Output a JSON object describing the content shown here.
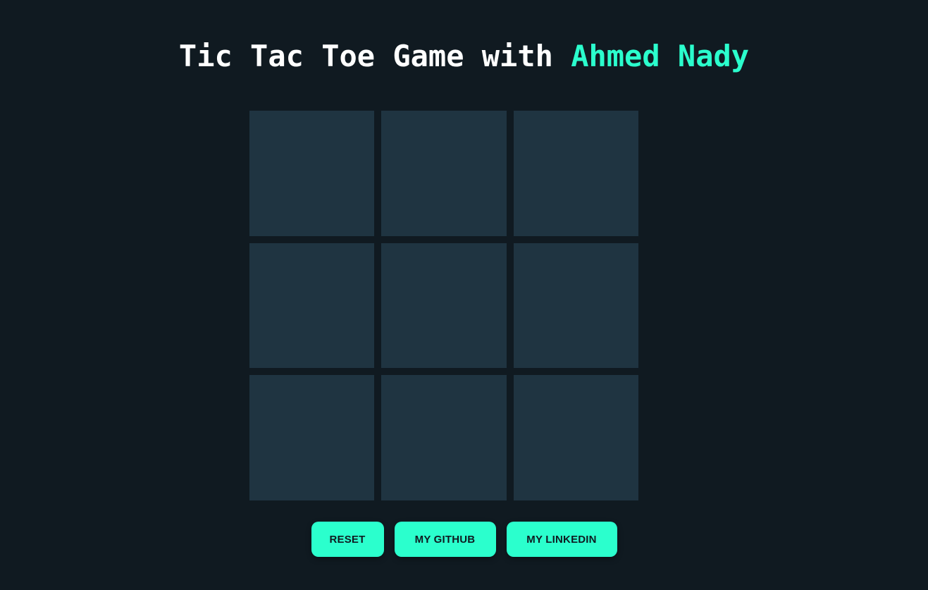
{
  "header": {
    "title_prefix": "Tic Tac Toe Game with ",
    "title_accent": "Ahmed Nady"
  },
  "board": {
    "cells": [
      "",
      "",
      "",
      "",
      "",
      "",
      "",
      "",
      ""
    ]
  },
  "buttons": {
    "reset_label": "RESET",
    "github_label": "MY GITHUB",
    "linkedin_label": "MY LINKEDIN"
  },
  "colors": {
    "background": "#101a21",
    "cell": "#1f3441",
    "accent": "#2bffcd",
    "title": "#ffffff"
  }
}
